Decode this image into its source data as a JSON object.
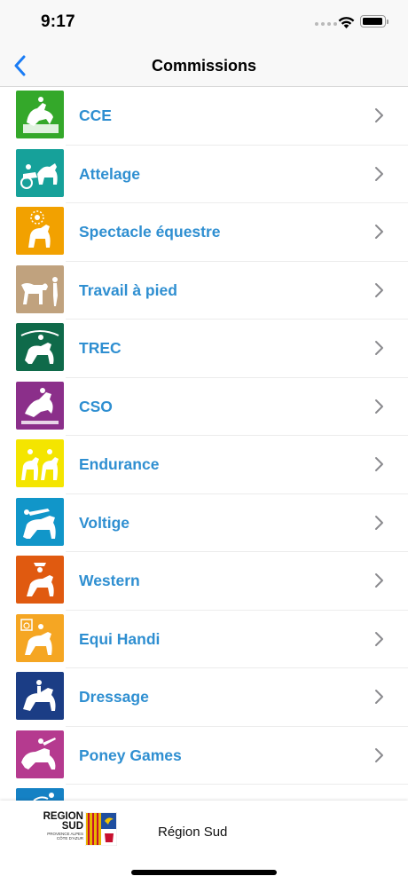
{
  "status_bar": {
    "time": "9:17"
  },
  "nav": {
    "title": "Commissions",
    "back_icon": "chevron-left-icon"
  },
  "commissions": [
    {
      "label": "CCE",
      "color": "#34a82a",
      "icon": "eventing-horse-icon"
    },
    {
      "label": "Attelage",
      "color": "#16a19a",
      "icon": "carriage-driving-icon"
    },
    {
      "label": "Spectacle équestre",
      "color": "#f2a100",
      "icon": "show-horse-icon"
    },
    {
      "label": "Travail à pied",
      "color": "#c0a27e",
      "icon": "groundwork-horse-icon"
    },
    {
      "label": "TREC",
      "color": "#0f6a4a",
      "icon": "trec-rider-icon"
    },
    {
      "label": "CSO",
      "color": "#8b2f8a",
      "icon": "show-jumping-icon"
    },
    {
      "label": "Endurance",
      "color": "#f4e500",
      "icon": "endurance-riders-icon"
    },
    {
      "label": "Voltige",
      "color": "#1196c9",
      "icon": "vaulting-icon"
    },
    {
      "label": "Western",
      "color": "#e05a10",
      "icon": "western-rider-icon"
    },
    {
      "label": "Equi Handi",
      "color": "#f5a623",
      "icon": "equi-handi-icon"
    },
    {
      "label": "Dressage",
      "color": "#1b3d85",
      "icon": "dressage-icon"
    },
    {
      "label": "Poney Games",
      "color": "#b53a8f",
      "icon": "pony-games-icon"
    },
    {
      "label": "",
      "color": "#1581c4",
      "icon": "partial-row-icon"
    }
  ],
  "footer": {
    "logo_title": "REGION SUD",
    "logo_subtitle": "PROVENCE ALPES CÔTE D'AZUR",
    "label": "Région Sud"
  }
}
